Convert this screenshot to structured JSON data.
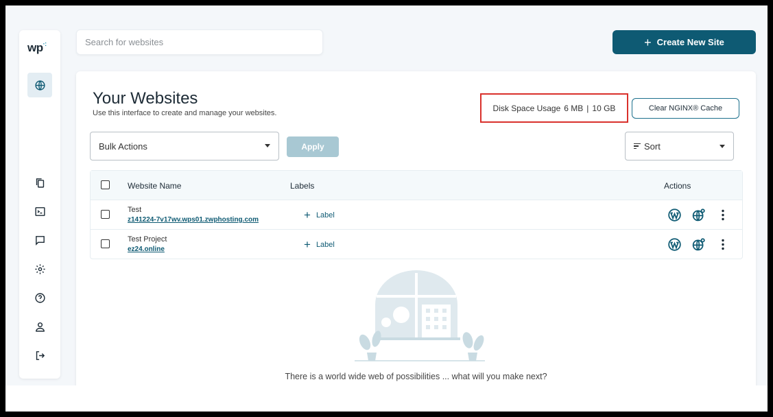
{
  "logo": {
    "text": "wp"
  },
  "sidebar": {
    "items": [
      {
        "name": "websites",
        "icon": "globe-icon",
        "active": true
      },
      {
        "name": "files",
        "icon": "copy-icon"
      },
      {
        "name": "terminal",
        "icon": "terminal-icon"
      },
      {
        "name": "messages",
        "icon": "chat-icon"
      },
      {
        "name": "settings",
        "icon": "gear-icon"
      },
      {
        "name": "help",
        "icon": "help-icon"
      },
      {
        "name": "account",
        "icon": "user-icon"
      },
      {
        "name": "logout",
        "icon": "logout-icon"
      }
    ]
  },
  "search": {
    "placeholder": "Search for websites"
  },
  "header": {
    "create_label": "Create New Site"
  },
  "main": {
    "title": "Your Websites",
    "subtitle": "Use this interface to create and manage your websites.",
    "disk": {
      "label": "Disk Space Usage",
      "used": "6 MB",
      "separator": "|",
      "total": "10 GB"
    },
    "clear_cache_label": "Clear NGINX® Cache",
    "bulk_actions": {
      "selected": "Bulk Actions"
    },
    "apply_label": "Apply",
    "sort": {
      "selected": "Sort"
    },
    "table": {
      "columns": [
        "Website Name",
        "Labels",
        "Actions"
      ],
      "rows": [
        {
          "name": "Test",
          "url": "z141224-7v17wv.wps01.zwphosting.com",
          "label_action": "Label"
        },
        {
          "name": "Test Project",
          "url": "ez24.online",
          "label_action": "Label"
        }
      ]
    },
    "empty_message": "There is a world wide web of possibilities ... what will you make next?"
  },
  "colors": {
    "primary": "#0e5a73",
    "highlight": "#d9302b",
    "apply_disabled": "#a8c8d3"
  }
}
